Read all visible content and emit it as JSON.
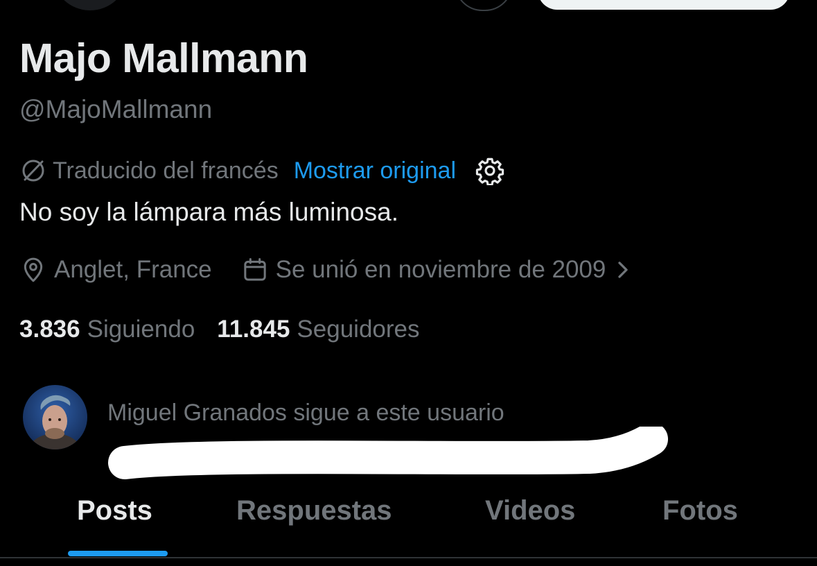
{
  "profile": {
    "display_name": "Majo Mallmann",
    "handle": "@MajoMallmann",
    "translated_label": "Traducido del francés",
    "show_original": "Mostrar original",
    "bio": "No soy la lámpara más luminosa.",
    "location": "Anglet, France",
    "joined": "Se unió en noviembre de 2009"
  },
  "stats": {
    "following_count": "3.836",
    "following_label": "Siguiendo",
    "followers_count": "11.845",
    "followers_label": "Seguidores"
  },
  "followed_by": {
    "text": "Miguel Granados sigue a este usuario"
  },
  "tabs": [
    {
      "label": "Posts",
      "active": true
    },
    {
      "label": "Respuestas",
      "active": false
    },
    {
      "label": "Videos",
      "active": false
    },
    {
      "label": "Fotos",
      "active": false
    }
  ],
  "colors": {
    "background": "#000000",
    "primary_text": "#e7e9ea",
    "secondary_text": "#71767b",
    "accent": "#1d9bf0"
  },
  "icons": {
    "translate": "translate-icon",
    "settings": "gear-icon",
    "location": "location-pin-icon",
    "calendar": "calendar-icon",
    "chevron": "chevron-right-icon"
  }
}
